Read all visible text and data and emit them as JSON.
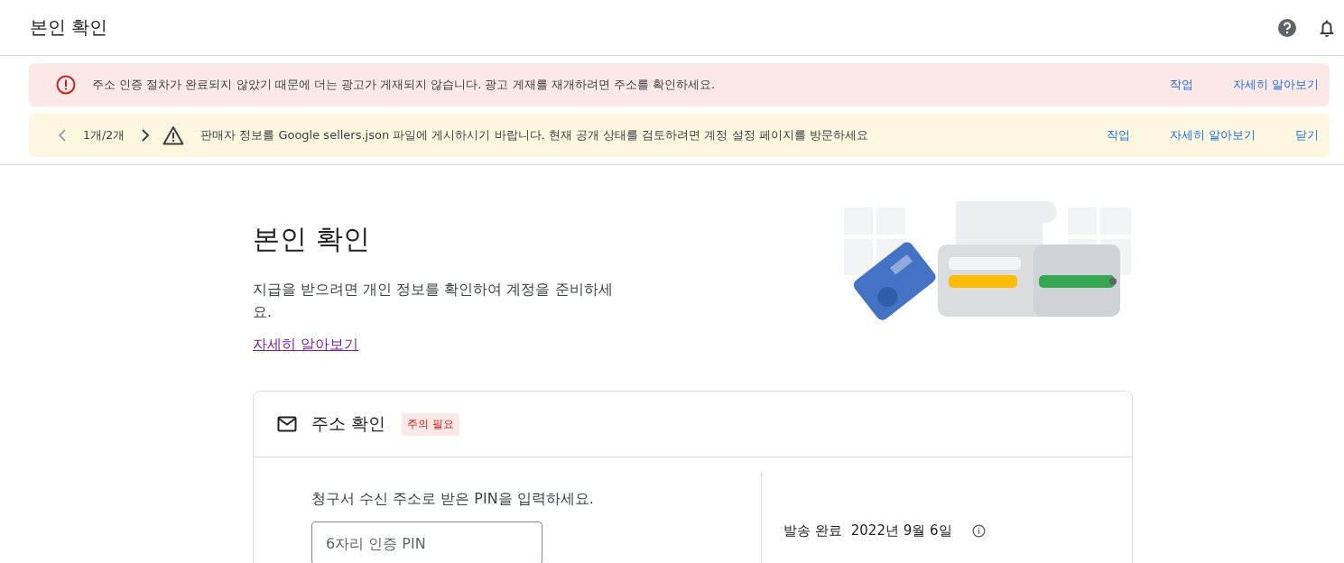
{
  "header": {
    "title": "본인 확인"
  },
  "banners": [
    {
      "kind": "error",
      "message": "주소 인증 절차가 완료되지 않았기 때문에 더는 광고가 게재되지 않습니다. 광고 게재를 재개하려면 주소를 확인하세요.",
      "actions": [
        "작업",
        "자세히 알아보기"
      ]
    },
    {
      "kind": "warning",
      "pager": "1개/2개",
      "message": "판매자 정보를 Google sellers.json 파일에 게시하시기 바랍니다. 현재 공개 상태를 검토하려면 계정 설정 페이지를 방문하세요",
      "actions": [
        "작업",
        "자세히 알아보기",
        "닫기"
      ]
    }
  ],
  "page": {
    "title": "본인 확인",
    "description": "지급을 받으려면 개인 정보를 확인하여 계정을 준비하세요.",
    "link": "자세히 알아보기"
  },
  "card": {
    "title": "주소 확인",
    "badge": "주의 필요",
    "instruction": "청구서 수신 주소로 받은 PIN을 입력하세요.",
    "pin_field": {
      "placeholder": "6자리 인증 PIN"
    },
    "sent_label": "발송 완료",
    "sent_date": "2022년 9월 6일"
  }
}
